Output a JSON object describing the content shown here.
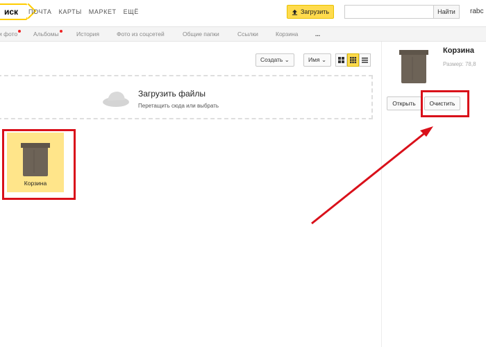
{
  "header": {
    "logo": "иск",
    "nav": [
      "ПОЧТА",
      "КАРТЫ",
      "МАРКЕТ",
      "ЕЩЁ"
    ],
    "upload_label": "Загрузить",
    "search_value": "",
    "search_button": "Найти",
    "user": "rabc"
  },
  "tabs": [
    {
      "label": "и фото",
      "badge": true
    },
    {
      "label": "Альбомы",
      "badge": true
    },
    {
      "label": "История",
      "badge": false
    },
    {
      "label": "Фото из соцсетей",
      "badge": false
    },
    {
      "label": "Общие папки",
      "badge": false
    },
    {
      "label": "Ссылки",
      "badge": false
    },
    {
      "label": "Корзина",
      "badge": false
    },
    {
      "label": "...",
      "badge": false
    }
  ],
  "toolbar": {
    "create_label": "Создать",
    "sort_label": "Имя"
  },
  "dropzone": {
    "title": "Загрузить файлы",
    "subtitle": "Перетащить сюда или выбрать"
  },
  "files": [
    {
      "name": "Корзина"
    }
  ],
  "details": {
    "title": "Корзина",
    "size": "Размер: 78,8",
    "open_label": "Открыть",
    "clear_label": "Очистить"
  },
  "colors": {
    "accent": "#ffdb4d",
    "highlight": "#d9101a",
    "trash": "#6d6357"
  }
}
